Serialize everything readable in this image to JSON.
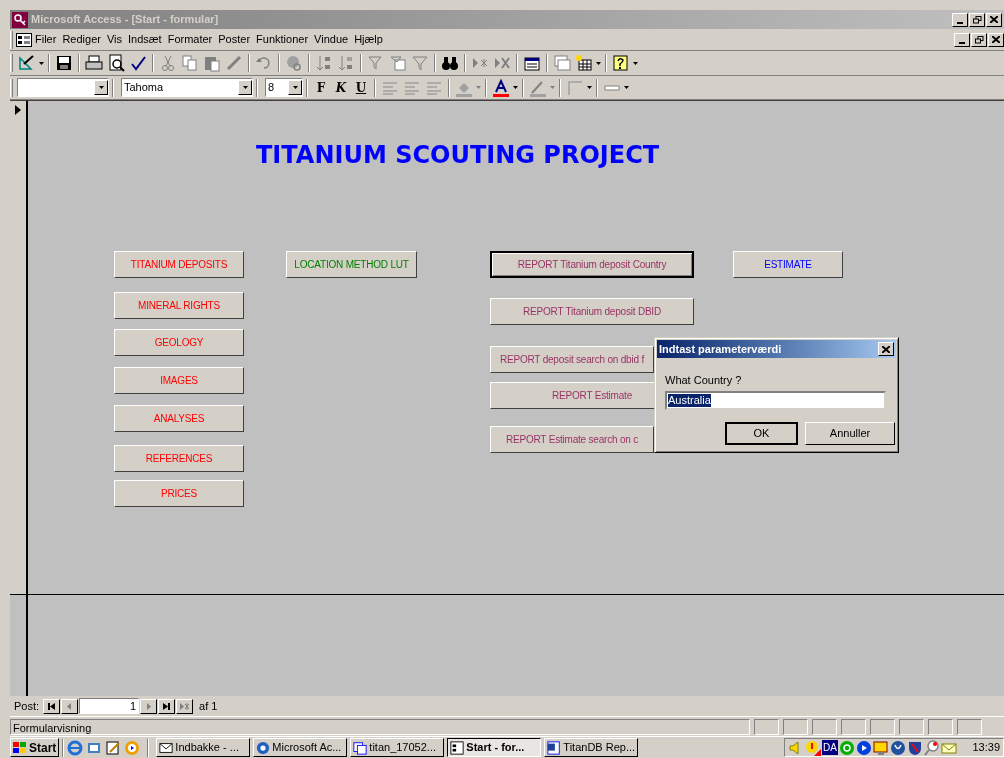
{
  "window": {
    "title": "Microsoft Access - [Start - formular]"
  },
  "menu": [
    "Filer",
    "Rediger",
    "Vis",
    "Indsæt",
    "Formater",
    "Poster",
    "Funktioner",
    "Vindue",
    "Hjælp"
  ],
  "format_toolbar": {
    "font_combo": "Tahoma",
    "size_combo": "8",
    "bold": "F",
    "italic": "K",
    "underline": "U"
  },
  "form": {
    "title": "TITANIUM SCOUTING PROJECT",
    "buttons": [
      {
        "label": "TITANIUM DEPOSITS",
        "color": "#ff0000",
        "default": false
      },
      {
        "label": "MINERAL RIGHTS",
        "color": "#ff0000",
        "default": false
      },
      {
        "label": "GEOLOGY",
        "color": "#ff0000",
        "default": false
      },
      {
        "label": "IMAGES",
        "color": "#ff0000",
        "default": false
      },
      {
        "label": "ANALYSES",
        "color": "#ff0000",
        "default": false
      },
      {
        "label": "REFERENCES",
        "color": "#ff0000",
        "default": false
      },
      {
        "label": "PRICES",
        "color": "#ff0000",
        "default": false
      },
      {
        "label": "LOCATION METHOD LUT",
        "color": "#008000",
        "default": false
      },
      {
        "label": "REPORT Titanium deposit Country",
        "color": "#993366",
        "default": true
      },
      {
        "label": "ESTIMATE",
        "color": "#0000ff",
        "default": false
      },
      {
        "label": "REPORT Titanium deposit DBID",
        "color": "#993366",
        "default": false
      },
      {
        "label": "REPORT deposit search on dbid f",
        "color": "#993366",
        "default": false
      },
      {
        "label": "REPORT Estimate",
        "color": "#993366",
        "default": false
      },
      {
        "label": "REPORT Estimate search on c",
        "color": "#993366",
        "default": false
      }
    ]
  },
  "dialog": {
    "title": "Indtast parameterværdi",
    "prompt": "What Country ?",
    "value": "Australia",
    "buttons": [
      "OK",
      "Annuller"
    ]
  },
  "navigation": {
    "label": "Post:",
    "record": "1",
    "of": "af 1"
  },
  "status_bar": {
    "text": "Formularvisning"
  },
  "taskbar": {
    "start": "Start",
    "tasks": [
      {
        "label": "Indbakke - ...",
        "selected": false
      },
      {
        "label": "Microsoft Ac...",
        "selected": false
      },
      {
        "label": "titan_17052...",
        "selected": false
      },
      {
        "label": "Start - for...",
        "selected": true
      },
      {
        "label": "TitanDB Rep...",
        "selected": false
      }
    ],
    "tray_badge": "DA",
    "clock": "13:39"
  }
}
